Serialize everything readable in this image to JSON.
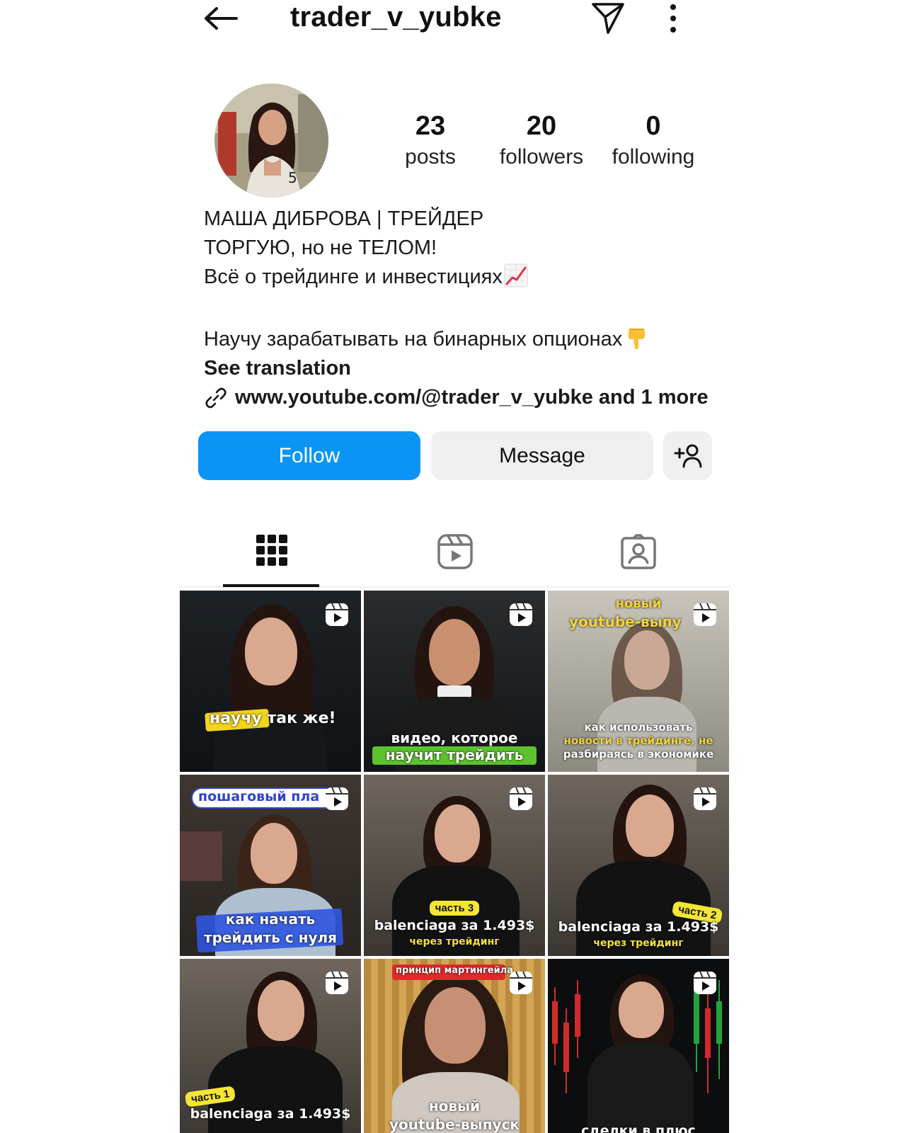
{
  "header": {
    "username": "trader_v_yubke"
  },
  "profile": {
    "stats": [
      {
        "value": "23",
        "label": "posts"
      },
      {
        "value": "20",
        "label": "followers"
      },
      {
        "value": "0",
        "label": "following"
      }
    ],
    "name": "МАША ДИБРОВА | ТРЕЙДЕР",
    "bio_line1": "ТОРГУЮ, но не ТЕЛОМ!",
    "bio_line2": "Всё о трейдинге и инвестициях",
    "bio_line3": "Научу зарабатывать на бинарных опционах",
    "see_translation": "See translation",
    "link_text": "www.youtube.com/@trader_v_yubke and 1 more"
  },
  "actions": {
    "follow_label": "Follow",
    "message_label": "Message"
  },
  "tabs": [
    "grid-tab",
    "reels-tab",
    "tagged-tab"
  ],
  "posts": [
    {
      "caption": "научу так же!"
    },
    {
      "caption1": "видео, которое",
      "caption2": "научит трейдить"
    },
    {
      "caption_top1": "новый",
      "caption_top2": "youtube-выпу",
      "caption1": "как использовать",
      "caption2": "новости в трейдинге, не",
      "caption3": "разбираясь в экономике"
    },
    {
      "caption_top": "пошаговый пла",
      "caption1": "как начать",
      "caption2": "трейдить с нуля"
    },
    {
      "tag": "часть 3",
      "caption1": "balenciaga за 1.493$",
      "caption2": "через трейдинг"
    },
    {
      "tag": "часть 2",
      "caption1": "balenciaga за 1.493$",
      "caption2": "через трейдинг"
    },
    {
      "tag": "часть 1",
      "caption1": "balenciaga за 1.493$"
    },
    {
      "caption_top": "принцип мартингейла",
      "caption1": "новый",
      "caption2": "youtube-выпуск"
    },
    {
      "caption1": "сделки в плюс"
    }
  ],
  "colors": {
    "accent": "#0a95f6",
    "secondary_button": "#efefef",
    "text": "#111111"
  }
}
